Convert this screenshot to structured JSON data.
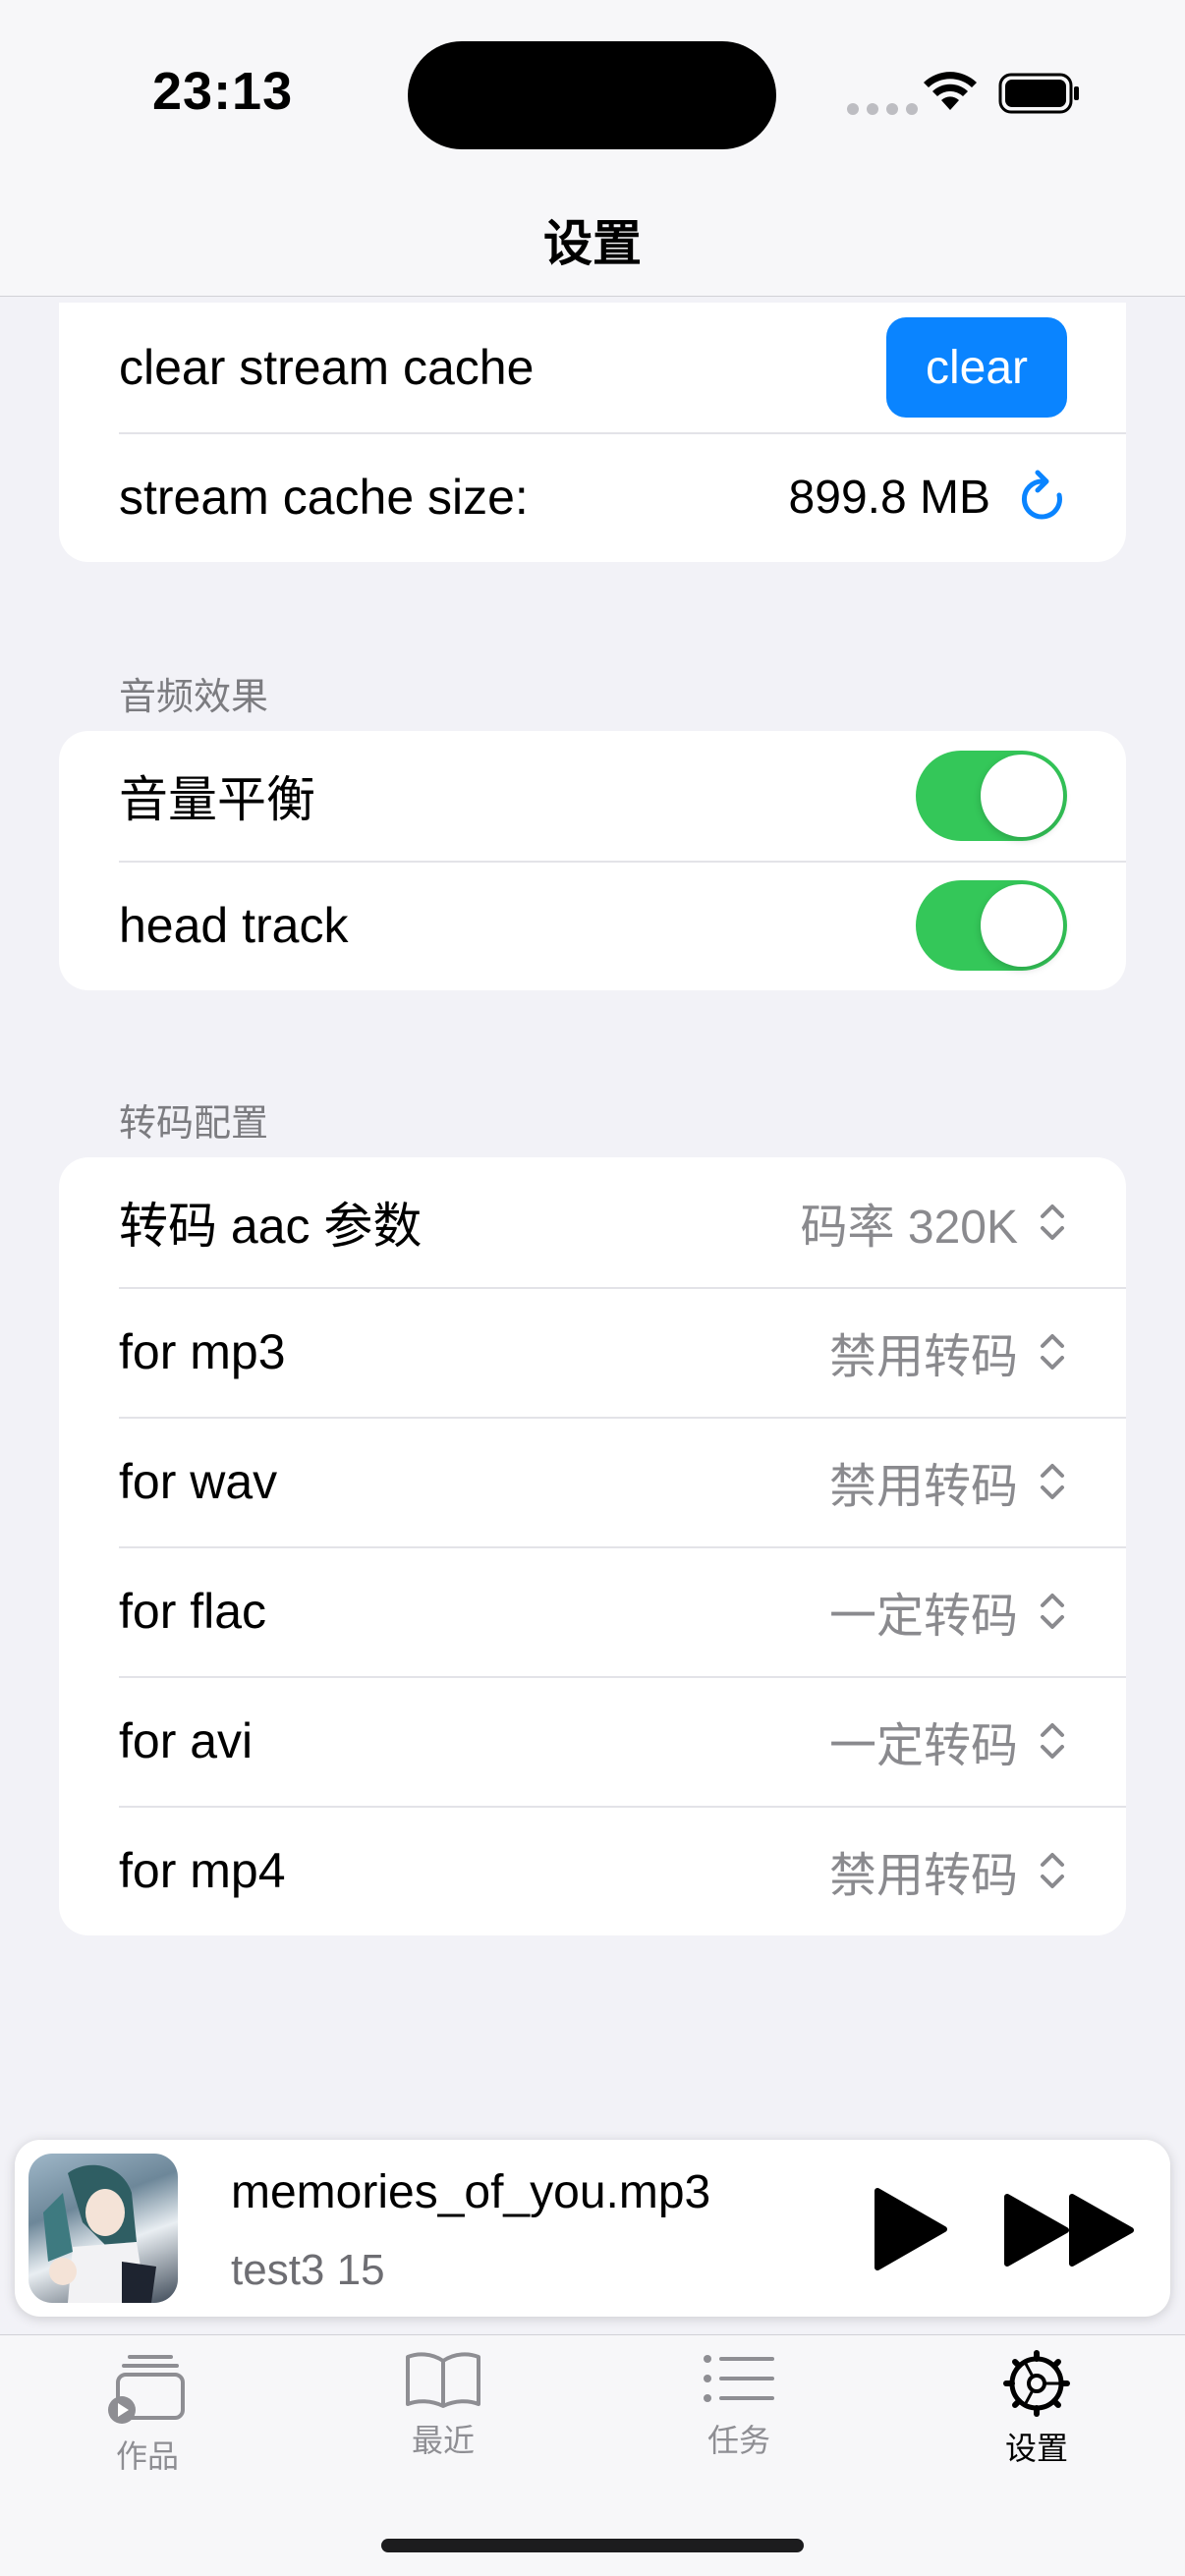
{
  "status_bar": {
    "time": "23:13"
  },
  "nav": {
    "title": "设置"
  },
  "stream_group": {
    "clear_row": {
      "label": "clear stream cache",
      "button_label": "clear"
    },
    "size_row": {
      "label": "stream cache size:",
      "value": "899.8 MB"
    }
  },
  "audio_effects": {
    "header": "音频效果",
    "rows": [
      {
        "label": "音量平衡",
        "on": true
      },
      {
        "label": "head track",
        "on": true
      }
    ]
  },
  "transcode": {
    "header": "转码配置",
    "rows": [
      {
        "label": "转码 aac 参数",
        "value": "码率 320K"
      },
      {
        "label": "for mp3",
        "value": "禁用转码"
      },
      {
        "label": "for wav",
        "value": "禁用转码"
      },
      {
        "label": "for flac",
        "value": "一定转码"
      },
      {
        "label": "for avi",
        "value": "一定转码"
      },
      {
        "label": "for mp4",
        "value": "禁用转码"
      }
    ]
  },
  "player": {
    "title": "memories_of_you.mp3",
    "subtitle": "test3 15"
  },
  "tabs": [
    {
      "label": "作品",
      "icon": "works-icon"
    },
    {
      "label": "最近",
      "icon": "book-icon"
    },
    {
      "label": "任务",
      "icon": "list-icon"
    },
    {
      "label": "设置",
      "icon": "gear-icon",
      "active": true
    }
  ],
  "colors": {
    "accent": "#0A84FF",
    "toggle_on": "#34C759",
    "background": "#F2F2F7"
  }
}
